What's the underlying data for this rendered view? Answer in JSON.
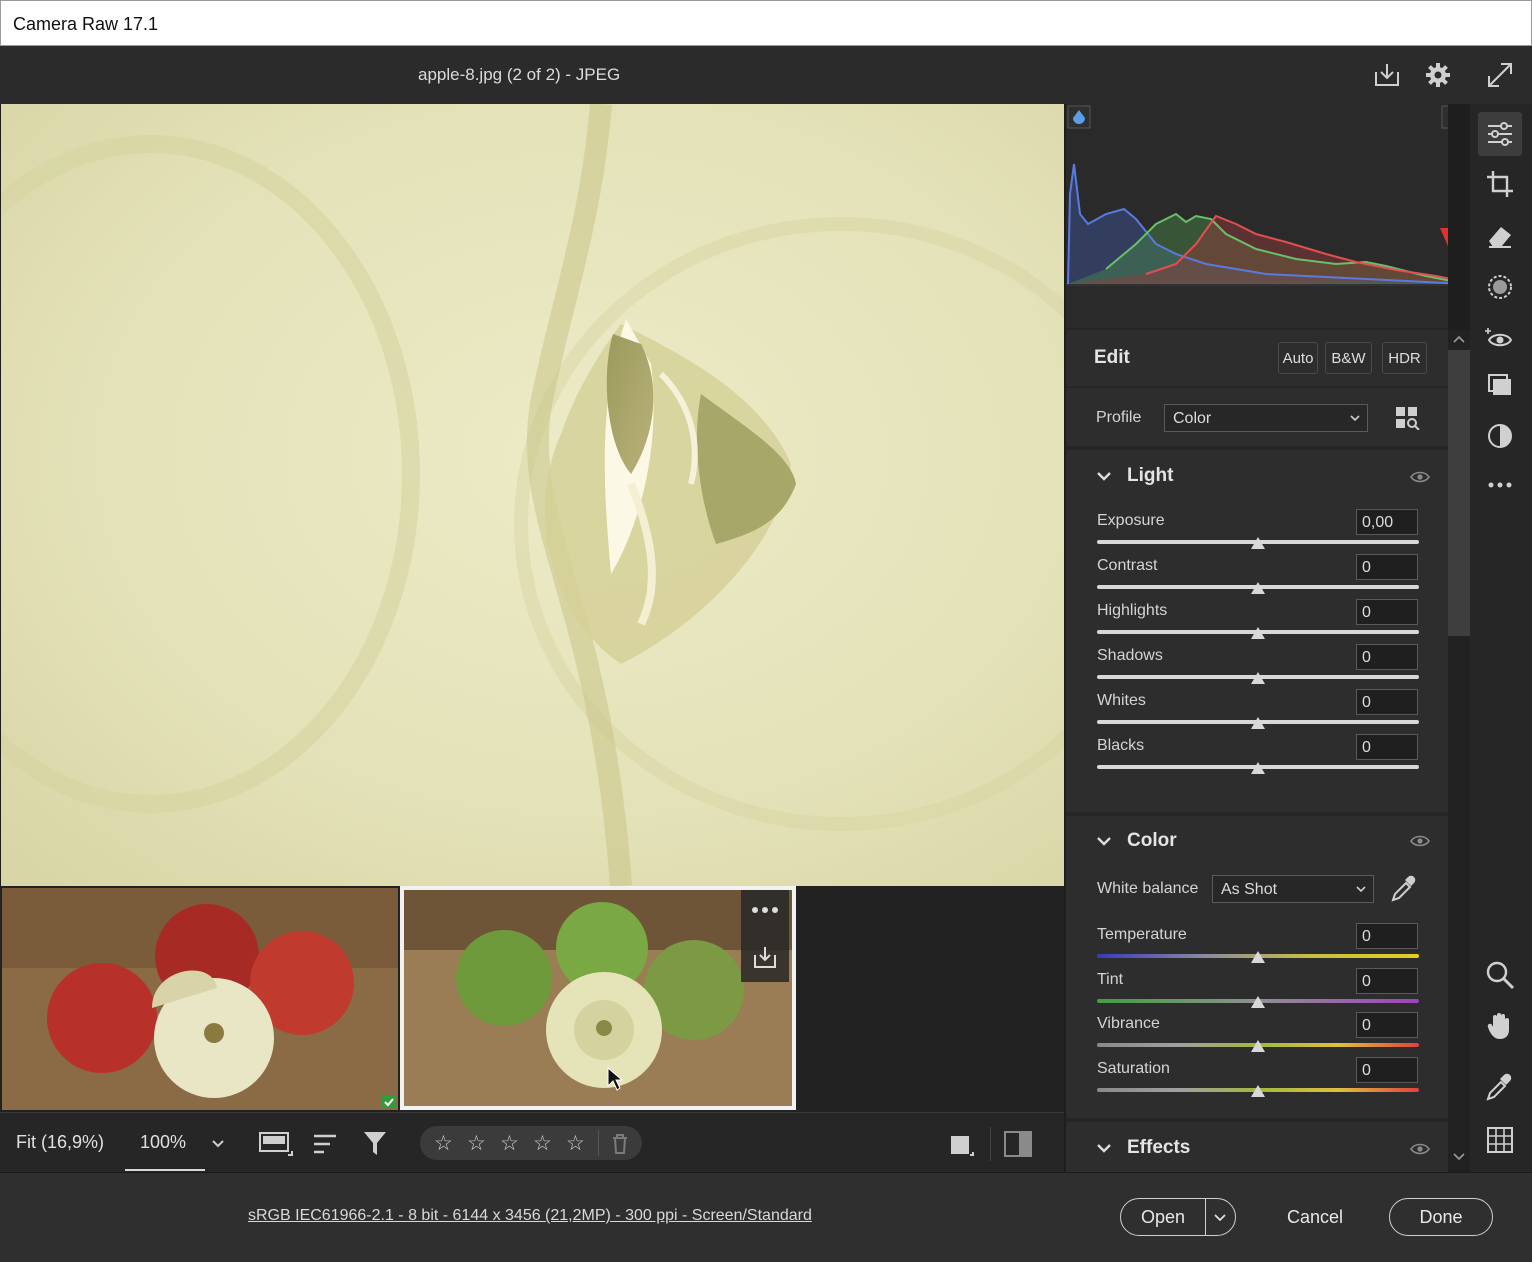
{
  "window": {
    "title": "Camera Raw 17.1"
  },
  "topbar": {
    "file_label": "apple-8.jpg (2 of 2)  -  JPEG"
  },
  "panel": {
    "edit_title": "Edit",
    "buttons": [
      "Auto",
      "B&W",
      "HDR"
    ],
    "profile": {
      "label": "Profile",
      "value": "Color"
    },
    "light": {
      "title": "Light",
      "sliders": [
        {
          "label": "Exposure",
          "value": "0,00"
        },
        {
          "label": "Contrast",
          "value": "0"
        },
        {
          "label": "Highlights",
          "value": "0"
        },
        {
          "label": "Shadows",
          "value": "0"
        },
        {
          "label": "Whites",
          "value": "0"
        },
        {
          "label": "Blacks",
          "value": "0"
        }
      ]
    },
    "color": {
      "title": "Color",
      "white_balance": {
        "label": "White balance",
        "value": "As Shot"
      },
      "sliders": [
        {
          "label": "Temperature",
          "value": "0"
        },
        {
          "label": "Tint",
          "value": "0"
        },
        {
          "label": "Vibrance",
          "value": "0"
        },
        {
          "label": "Saturation",
          "value": "0"
        }
      ]
    },
    "effects": {
      "title": "Effects"
    }
  },
  "bottombar": {
    "fit_label": "Fit (16,9%)",
    "zoom_value": "100%",
    "stars": [
      "☆",
      "☆",
      "☆",
      "☆",
      "☆"
    ]
  },
  "statusbar": {
    "info": "sRGB IEC61966-2.1 - 8 bit - 6144 x 3456 (21,2MP) - 300 ppi - Screen/Standard",
    "open_label": "Open",
    "cancel_label": "Cancel",
    "done_label": "Done"
  },
  "colors": {
    "accent_red": "#e03030",
    "panel_bg": "#262626",
    "app_bg": "#1e1e1e"
  }
}
